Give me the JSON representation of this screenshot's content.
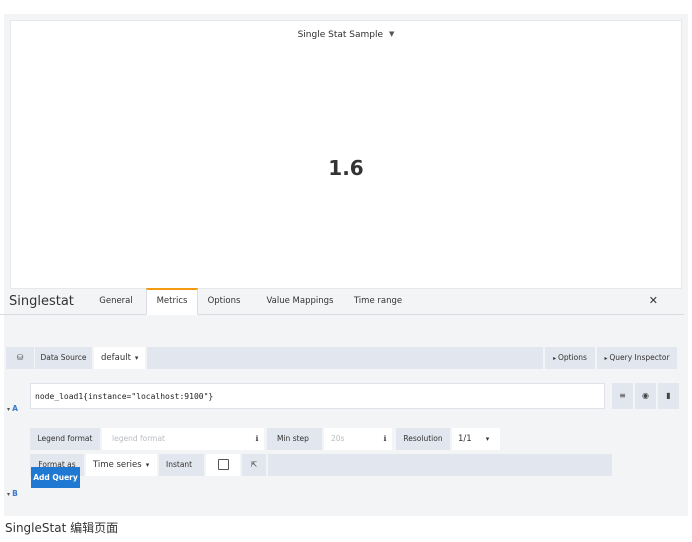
{
  "panel": {
    "title": "Single Stat Sample",
    "value": "1.6"
  },
  "editor": {
    "title": "Singlestat",
    "tabs": [
      "General",
      "Metrics",
      "Options",
      "Value Mappings",
      "Time range"
    ],
    "active_tab": "Metrics"
  },
  "datasource": {
    "label": "Data Source",
    "value": "default",
    "options_btn": "Options",
    "inspector_btn": "Query Inspector"
  },
  "query_a": {
    "letter": "A",
    "expr": "node_load1{instance=\"localhost:9100\"}",
    "legend_label": "Legend format",
    "legend_placeholder": "legend format",
    "minstep_label": "Min step",
    "minstep_placeholder": "20s",
    "resolution_label": "Resolution",
    "resolution_value": "1/1",
    "format_label": "Format as",
    "format_value": "Time series",
    "instant_label": "Instant"
  },
  "query_b": {
    "letter": "B",
    "add_label": "Add Query"
  },
  "caption": "SingleStat 编辑页面",
  "colors": {
    "accent": "#f39c12",
    "primary": "#1f78d1",
    "query_letter": "#3a7ad0"
  }
}
